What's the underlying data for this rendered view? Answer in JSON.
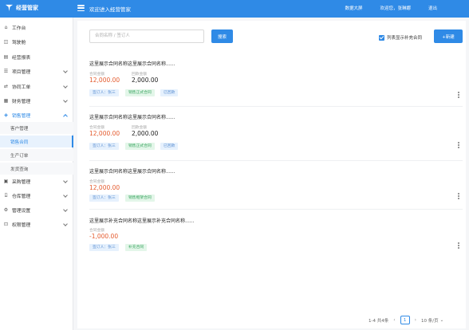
{
  "header": {
    "app_name": "经营管家",
    "welcome": "欢迎进入经营管家",
    "links": [
      "数据大屏",
      "欢迎您，张琳娜",
      "退出"
    ]
  },
  "sidebar": {
    "items": [
      {
        "label": "工作台",
        "icon": "home-icon"
      },
      {
        "label": "驾驶舱",
        "icon": "cockpit-icon"
      },
      {
        "label": "经营报表",
        "icon": "report-icon"
      },
      {
        "label": "项目管理",
        "icon": "project-icon",
        "expandable": true
      },
      {
        "label": "协同工单",
        "icon": "workorder-icon",
        "expandable": true
      },
      {
        "label": "财务管理",
        "icon": "finance-icon",
        "expandable": true
      },
      {
        "label": "销售管理",
        "icon": "sales-icon",
        "expandable": true,
        "open": true
      },
      {
        "label": "采购管理",
        "icon": "purchase-icon",
        "expandable": true
      },
      {
        "label": "仓库管理",
        "icon": "warehouse-icon",
        "expandable": true
      },
      {
        "label": "管理设置",
        "icon": "settings-icon",
        "expandable": true
      },
      {
        "label": "权限管理",
        "icon": "permission-icon",
        "expandable": true
      }
    ],
    "sales_sub": [
      "客户管理",
      "销售合同",
      "生产订单",
      "发货查询"
    ],
    "active_sub": "销售合同"
  },
  "toolbar": {
    "search_placeholder": "合同名称 / 签订人",
    "search_button": "搜索",
    "checkbox_label": "列表显示补充合同",
    "checkbox_checked": true,
    "new_button": "+新建"
  },
  "contracts": [
    {
      "title": "这里展示合同名称这里展示合同名称......",
      "amount_label": "合同金额",
      "amount": "12,000.00",
      "paid_label": "回款金额",
      "paid": "2,000.00",
      "tags": [
        "签订人：张三",
        "销售正式合同",
        "已回款"
      ]
    },
    {
      "title": "这里展示合同名称这里展示合同名称......",
      "amount_label": "合同金额",
      "amount": "12,000.00",
      "paid_label": "回款金额",
      "paid": "2,000.00",
      "tags": [
        "签订人：张三",
        "销售正式合同",
        "已回款"
      ]
    },
    {
      "title": "这里展示合同名称这里展示合同名称......",
      "amount_label": "合同金额",
      "amount": "12,000.00",
      "tags": [
        "签订人：张三",
        "销售框架合同"
      ]
    },
    {
      "title": "这里展示补充合同名称这里展示补充合同名称......",
      "amount_label": "合同金额",
      "amount": "-1,000.00",
      "tags": [
        "签订人：张三",
        "补充合同"
      ]
    }
  ],
  "pagination": {
    "summary": "1-4 共4条",
    "current_page": "1",
    "page_size": "10 条/页"
  },
  "colors": {
    "primary": "#2f8ae6",
    "amount": "#e45b2e"
  }
}
